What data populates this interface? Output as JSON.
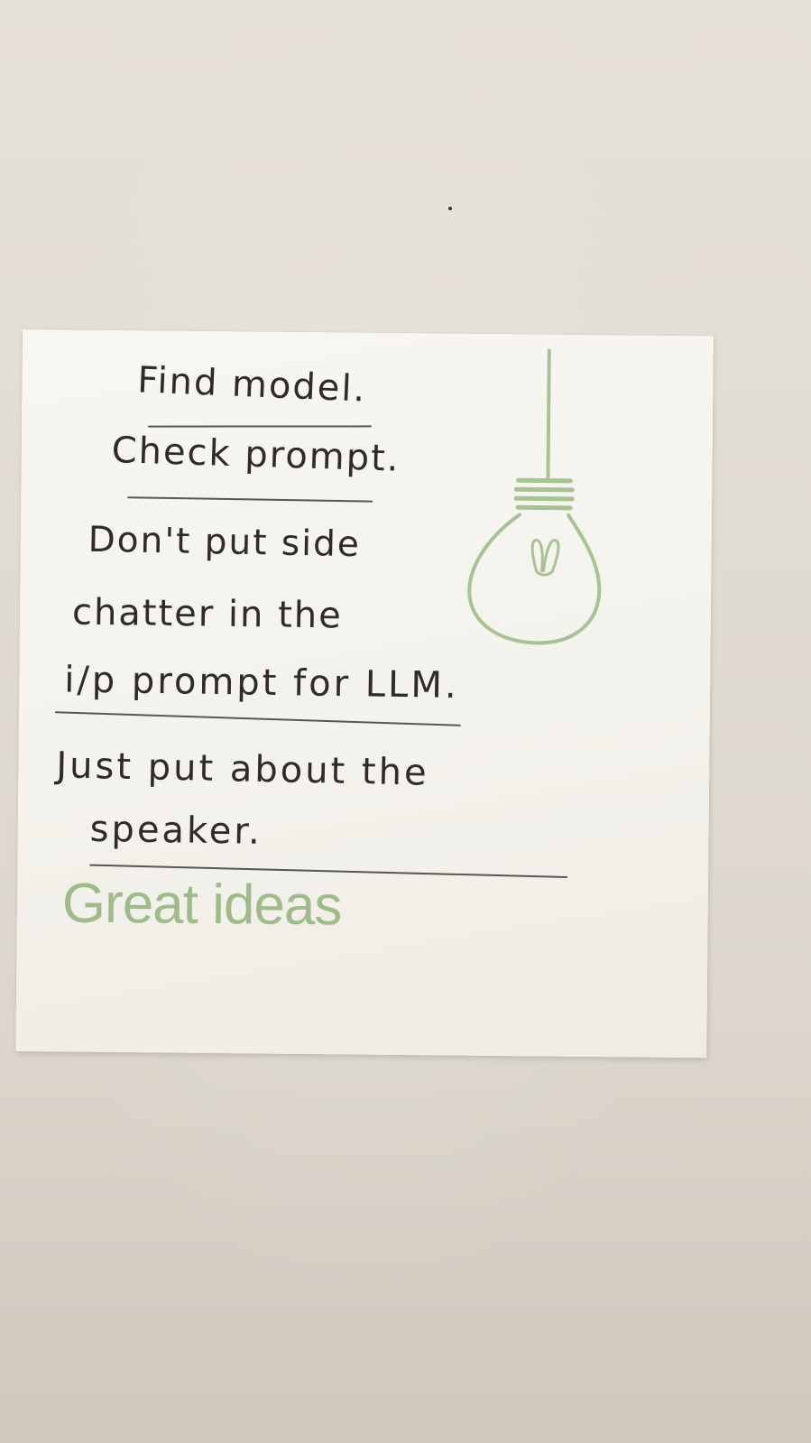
{
  "note": {
    "lines": [
      "Find model.",
      "Check prompt.",
      "Don't put side",
      "chatter in the",
      "i/p prompt for LLM.",
      "Just put about the",
      "speaker."
    ],
    "brand": "Great ideas"
  },
  "colors": {
    "wall": "#e2ddd4",
    "paper": "#f5f3ed",
    "ink": "#2e2b2a",
    "brand_green": "#9fbb8c"
  },
  "icons": {
    "bulb": "light-bulb-icon"
  }
}
